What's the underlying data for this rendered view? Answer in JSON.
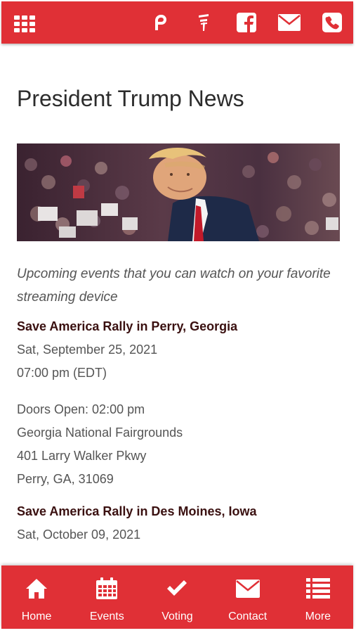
{
  "header": {
    "icons": [
      "apps-grid-icon",
      "parler-icon",
      "gettr-icon",
      "facebook-icon",
      "email-icon",
      "phone-icon"
    ]
  },
  "page": {
    "title": "President Trump News",
    "subtitle": "Upcoming events that you can watch on your favorite streaming device"
  },
  "events": [
    {
      "title": "Save America Rally in Perry, Georgia",
      "date": "Sat, September 25, 2021",
      "time": "07:00 pm (EDT)",
      "doors": "Doors Open: 02:00 pm",
      "venue": "Georgia National Fairgrounds",
      "address": "401 Larry Walker Pkwy",
      "city": "Perry, GA, 31069"
    },
    {
      "title": "Save America Rally in Des Moines, Iowa",
      "date": "Sat, October 09, 2021"
    }
  ],
  "nav": {
    "items": [
      {
        "label": "Home",
        "icon": "home-icon"
      },
      {
        "label": "Events",
        "icon": "calendar-icon"
      },
      {
        "label": "Voting",
        "icon": "checkmark-icon"
      },
      {
        "label": "Contact",
        "icon": "envelope-icon"
      },
      {
        "label": "More",
        "icon": "list-icon"
      }
    ]
  },
  "colors": {
    "brand_red": "#e03036",
    "title_text": "#2c2c2c",
    "event_title": "#3a1010",
    "body_text": "#555555"
  }
}
